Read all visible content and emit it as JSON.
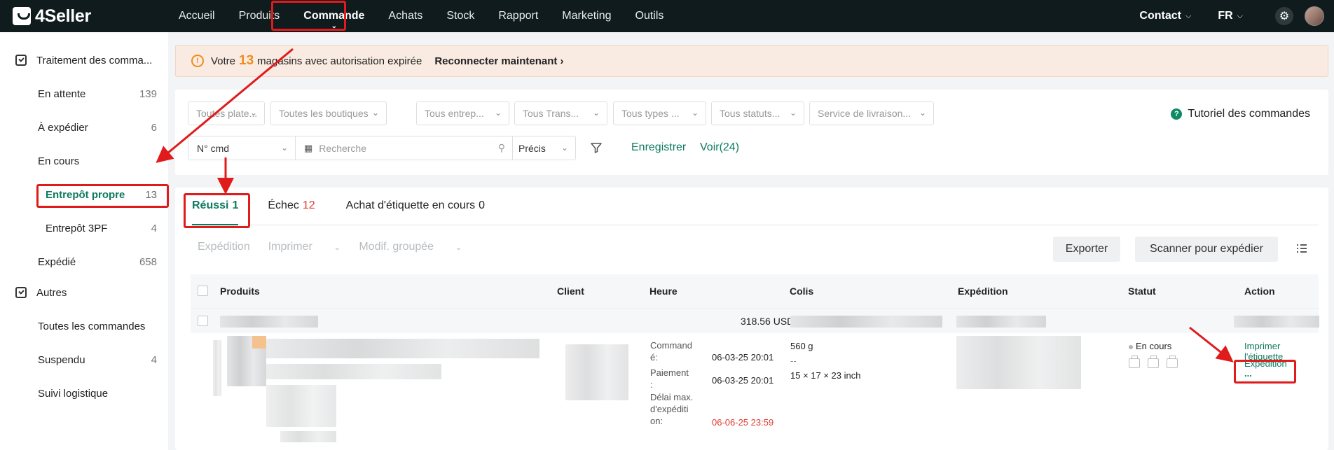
{
  "topnav": {
    "brand": "4Seller",
    "items": [
      "Accueil",
      "Produits",
      "Commande",
      "Achats",
      "Stock",
      "Rapport",
      "Marketing",
      "Outils"
    ],
    "active": "Commande",
    "contact": "Contact",
    "lang": "FR"
  },
  "sidebar": {
    "group1": "Traitement des comma...",
    "items": [
      {
        "label": "En attente",
        "count": "139"
      },
      {
        "label": "À expédier",
        "count": "6"
      },
      {
        "label": "En cours",
        "count": ""
      },
      {
        "label": "Entrepôt propre",
        "count": "13"
      },
      {
        "label": "Entrepôt 3PF",
        "count": "4"
      },
      {
        "label": "Expédié",
        "count": "658"
      }
    ],
    "group2": "Autres",
    "others": [
      {
        "label": "Toutes les commandes",
        "count": ""
      },
      {
        "label": "Suspendu",
        "count": "4"
      },
      {
        "label": "Suivi logistique",
        "count": ""
      }
    ]
  },
  "alert": {
    "prefix": "Votre",
    "count": "13",
    "suffix": "magasins avec autorisation expirée",
    "link": "Reconnecter maintenant"
  },
  "filters": {
    "selects": [
      "Toutes plate...",
      "Toutes les boutiques",
      "Tous entrep...",
      "Tous Trans...",
      "Tous types ...",
      "Tous statuts...",
      "Service de livraison..."
    ],
    "tutorial": "Tutoriel des commandes",
    "search_type": "N° cmd",
    "search_placeholder": "Recherche",
    "match": "Précis",
    "save": "Enregistrer",
    "view": "Voir(24)"
  },
  "tabs": [
    {
      "label": "Réussi",
      "count": "1"
    },
    {
      "label": "Échec",
      "count": "12"
    },
    {
      "label": "Achat d'étiquette en cours",
      "count": "0"
    }
  ],
  "toolbar": {
    "shipping": "Expédition",
    "print": "Imprimer",
    "bulk": "Modif. groupée",
    "export": "Exporter",
    "scan": "Scanner pour expédier"
  },
  "table": {
    "headers": [
      "Produits",
      "Client",
      "Heure",
      "Colis",
      "Expédition",
      "Statut",
      "Action"
    ],
    "summary_amount": "318.56 USD",
    "order": {
      "time_labels": {
        "ordered": "Command\né:",
        "payment": "Paiement\n:",
        "deadline": "Délai max.\nd'expéditi\non:"
      },
      "ordered_at": "06-03-25 20:01",
      "paid_at": "06-03-25 20:01",
      "deadline": "06-06-25 23:59",
      "weight": "560 g",
      "weight_dash": "--",
      "dimensions": "15 × 17 × 23 inch",
      "status": "En cours",
      "actions": [
        "Imprimer l'étiquette",
        "Expédition",
        "..."
      ]
    }
  },
  "colors": {
    "accent": "#0d7a5f",
    "nav_bg": "#0f1b1d",
    "warning": "#f08c1c",
    "danger": "#e03c31",
    "annotation": "#e01b1b"
  }
}
